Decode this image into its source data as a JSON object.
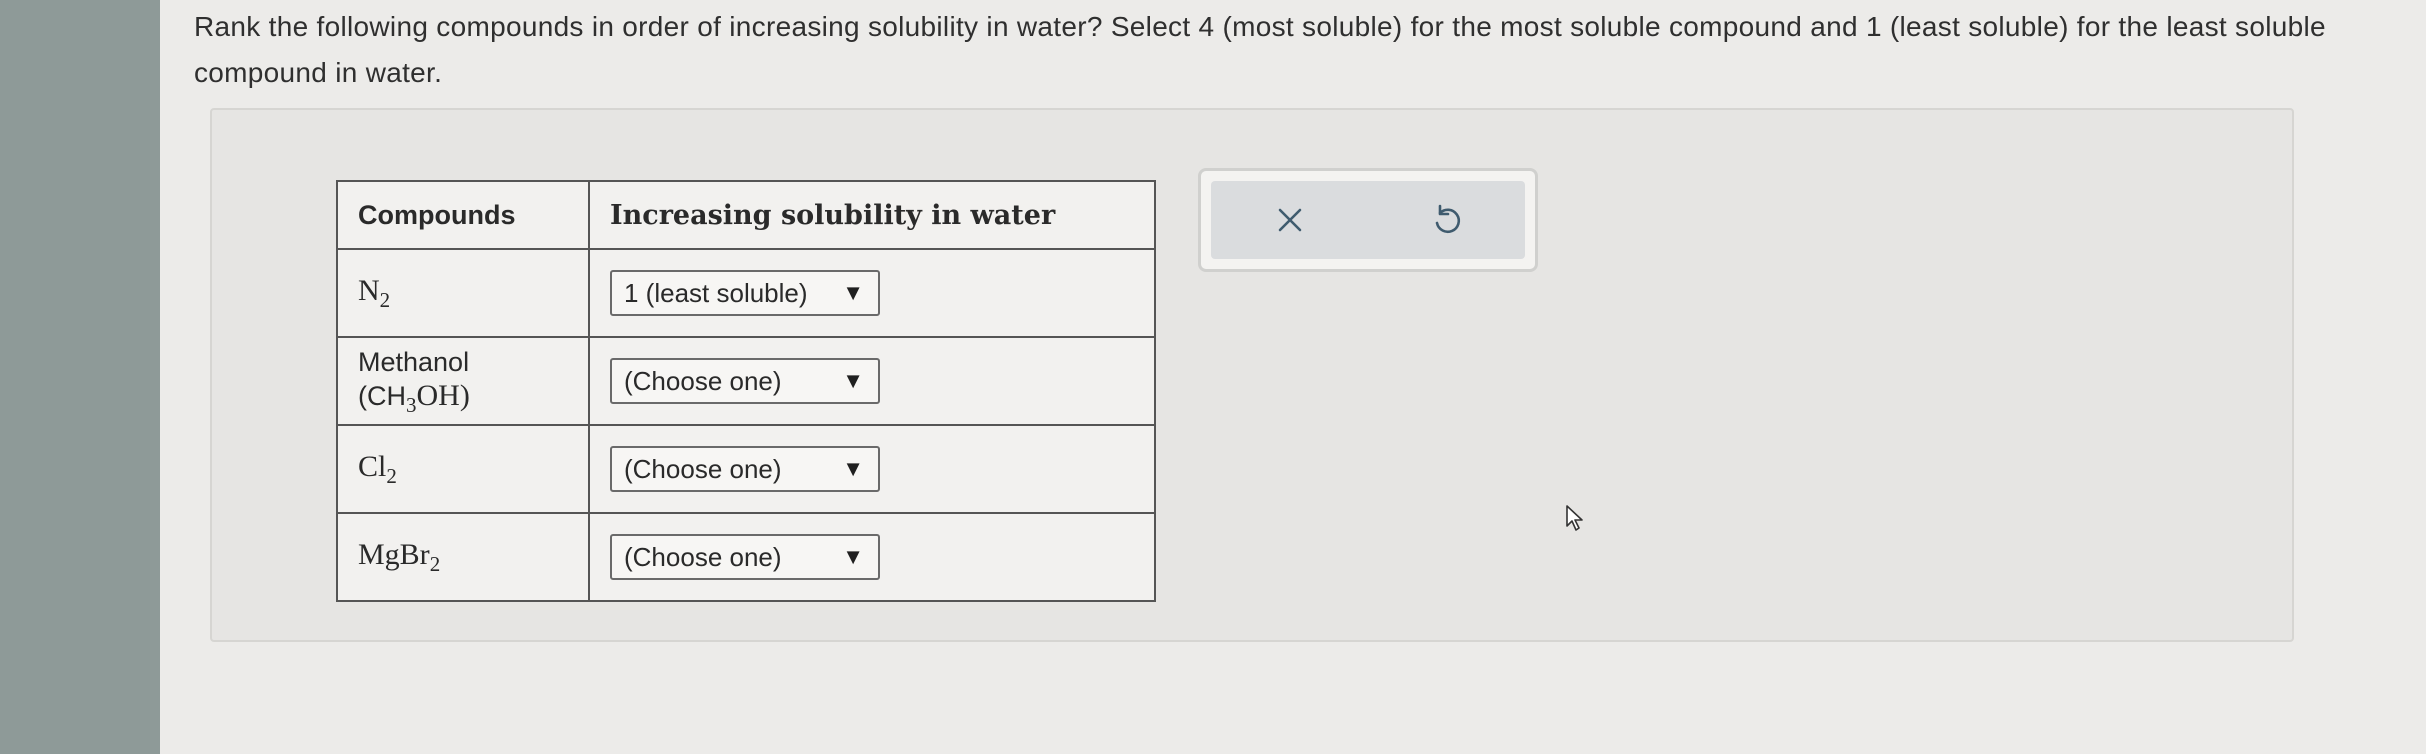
{
  "question": {
    "text": "Rank the following compounds in order of increasing solubility in water? Select 4 (most soluble) for the most soluble compound and 1 (least soluble) for the least soluble compound in water."
  },
  "table": {
    "headers": {
      "compounds": "Compounds",
      "solubility": "Increasing solubility in water"
    },
    "rows": [
      {
        "compound_base": "N",
        "compound_sub": "2",
        "compound_tail": "",
        "selected": "1 (least soluble)"
      },
      {
        "compound_prefix": "Methanol (CH",
        "compound_sub": "3",
        "compound_tail": "OH)",
        "selected": "(Choose one)"
      },
      {
        "compound_base": "Cl",
        "compound_sub": "2",
        "compound_tail": "",
        "selected": "(Choose one)"
      },
      {
        "compound_base": "MgBr",
        "compound_sub": "2",
        "compound_tail": "",
        "selected": "(Choose one)"
      }
    ]
  },
  "controls": {
    "clear_icon": "close-icon",
    "reset_icon": "undo-icon"
  },
  "icons": {
    "dropdown_caret": "▼"
  }
}
